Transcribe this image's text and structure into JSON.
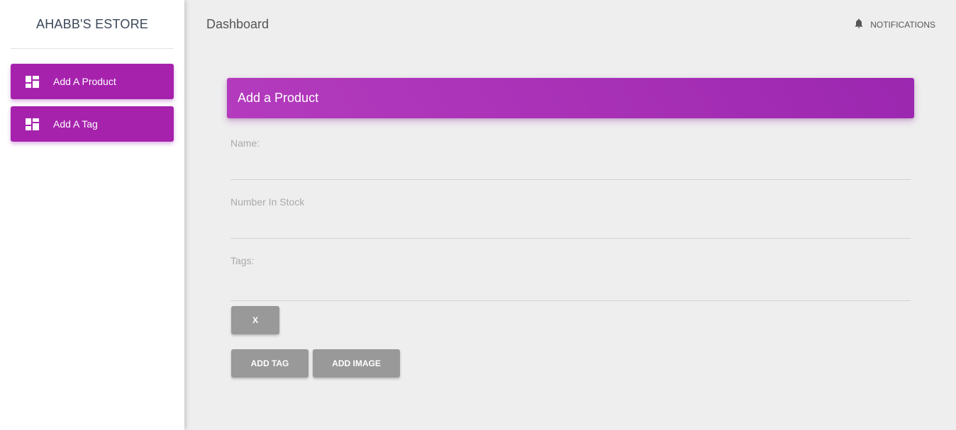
{
  "sidebar": {
    "brand": "AHABB'S ESTORE",
    "items": [
      {
        "label": "Add A Product",
        "icon": "dashboard-icon"
      },
      {
        "label": "Add A Tag",
        "icon": "dashboard-icon"
      }
    ]
  },
  "topbar": {
    "title": "Dashboard",
    "notifications_label": "NOTIFICATIONS",
    "notifications_icon": "bell-icon"
  },
  "card": {
    "title": "Add a Product",
    "fields": {
      "name": {
        "label": "Name:",
        "value": ""
      },
      "stock": {
        "label": "Number In Stock",
        "value": ""
      },
      "tags": {
        "label": "Tags:",
        "value": ""
      }
    },
    "buttons": {
      "remove_tag": "X",
      "add_tag": "ADD TAG",
      "add_image": "ADD IMAGE"
    }
  },
  "colors": {
    "accent": "#9c27b0",
    "nav_item": "#a622ad",
    "button_gray": "#999999",
    "background": "#eeeeee"
  }
}
